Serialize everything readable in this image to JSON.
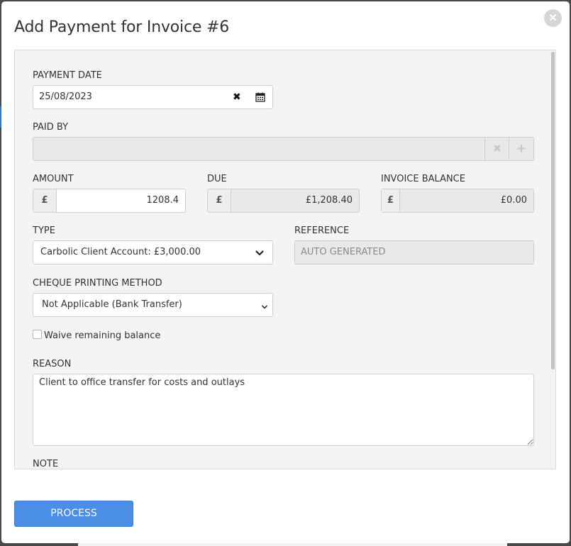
{
  "modal": {
    "title": "Add Payment for Invoice #6",
    "close_icon": "close-circle-icon"
  },
  "form": {
    "payment_date": {
      "label": "PAYMENT DATE",
      "value": "25/08/2023",
      "clear_icon": "clear-x-icon",
      "calendar_icon": "calendar-icon"
    },
    "paid_by": {
      "label": "PAID BY",
      "value": "",
      "clear_icon": "clear-x-icon",
      "add_icon": "plus-icon"
    },
    "amount": {
      "label": "AMOUNT",
      "currency": "£",
      "value": "1208.4"
    },
    "due": {
      "label": "DUE",
      "currency": "£",
      "value": "£1,208.40"
    },
    "invoice_balance": {
      "label": "INVOICE BALANCE",
      "currency": "£",
      "value": "£0.00"
    },
    "type": {
      "label": "TYPE",
      "value": "Carbolic Client Account: £3,000.00"
    },
    "reference": {
      "label": "REFERENCE",
      "placeholder": "AUTO GENERATED"
    },
    "cheque_printing_method": {
      "label": "CHEQUE PRINTING METHOD",
      "value": "Not Applicable (Bank Transfer)"
    },
    "waive_remaining_balance": {
      "label": "Waive remaining balance",
      "checked": false
    },
    "reason": {
      "label": "REASON",
      "value": "Client to office transfer for costs and outlays"
    },
    "note": {
      "label": "NOTE"
    }
  },
  "footer": {
    "process_label": "PROCESS"
  },
  "colors": {
    "primary": "#4a8ee6",
    "panel_bg": "#f4f4f4",
    "disabled_bg": "#e9e9e9"
  }
}
